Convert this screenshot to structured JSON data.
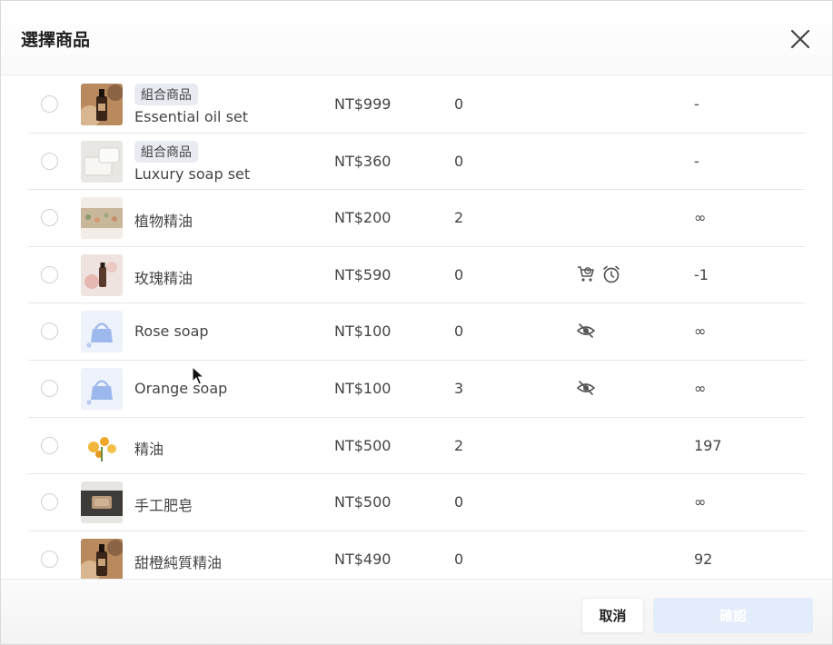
{
  "dialog": {
    "title": "選擇商品",
    "cancel_label": "取消",
    "confirm_label": "確認"
  },
  "products": [
    {
      "badge": "組合商品",
      "name": "Essential oil set",
      "price": "NT$999",
      "stock": "0",
      "status_icons": [],
      "qty": "-",
      "thumb": "oil-bottle"
    },
    {
      "badge": "組合商品",
      "name": "Luxury soap set",
      "price": "NT$360",
      "stock": "0",
      "status_icons": [],
      "qty": "-",
      "thumb": "soap-bar"
    },
    {
      "badge": "",
      "name": "植物精油",
      "price": "NT$200",
      "stock": "2",
      "status_icons": [],
      "qty": "∞",
      "thumb": "herbs"
    },
    {
      "badge": "",
      "name": "玫瑰精油",
      "price": "NT$590",
      "stock": "0",
      "status_icons": [
        "preorder-cart-icon",
        "alarm-clock-icon"
      ],
      "qty": "-1",
      "thumb": "rose-oil"
    },
    {
      "badge": "",
      "name": "Rose soap",
      "price": "NT$100",
      "stock": "0",
      "status_icons": [
        "hidden-eye-icon"
      ],
      "qty": "∞",
      "thumb": "placeholder-bag"
    },
    {
      "badge": "",
      "name": "Orange soap",
      "price": "NT$100",
      "stock": "3",
      "status_icons": [
        "hidden-eye-icon"
      ],
      "qty": "∞",
      "thumb": "placeholder-bag"
    },
    {
      "badge": "",
      "name": "精油",
      "price": "NT$500",
      "stock": "2",
      "status_icons": [],
      "qty": "197",
      "thumb": "flowers"
    },
    {
      "badge": "",
      "name": "手工肥皂",
      "price": "NT$500",
      "stock": "0",
      "status_icons": [],
      "qty": "∞",
      "thumb": "handmade-soap"
    },
    {
      "badge": "",
      "name": "甜橙純質精油",
      "price": "NT$490",
      "stock": "0",
      "status_icons": [],
      "qty": "92",
      "thumb": "oil-bottle"
    }
  ],
  "colors": {
    "confirm_disabled": "#e3ecfb",
    "badge_bg": "#e8ebf2",
    "placeholder_bag": "#9db8ec"
  }
}
